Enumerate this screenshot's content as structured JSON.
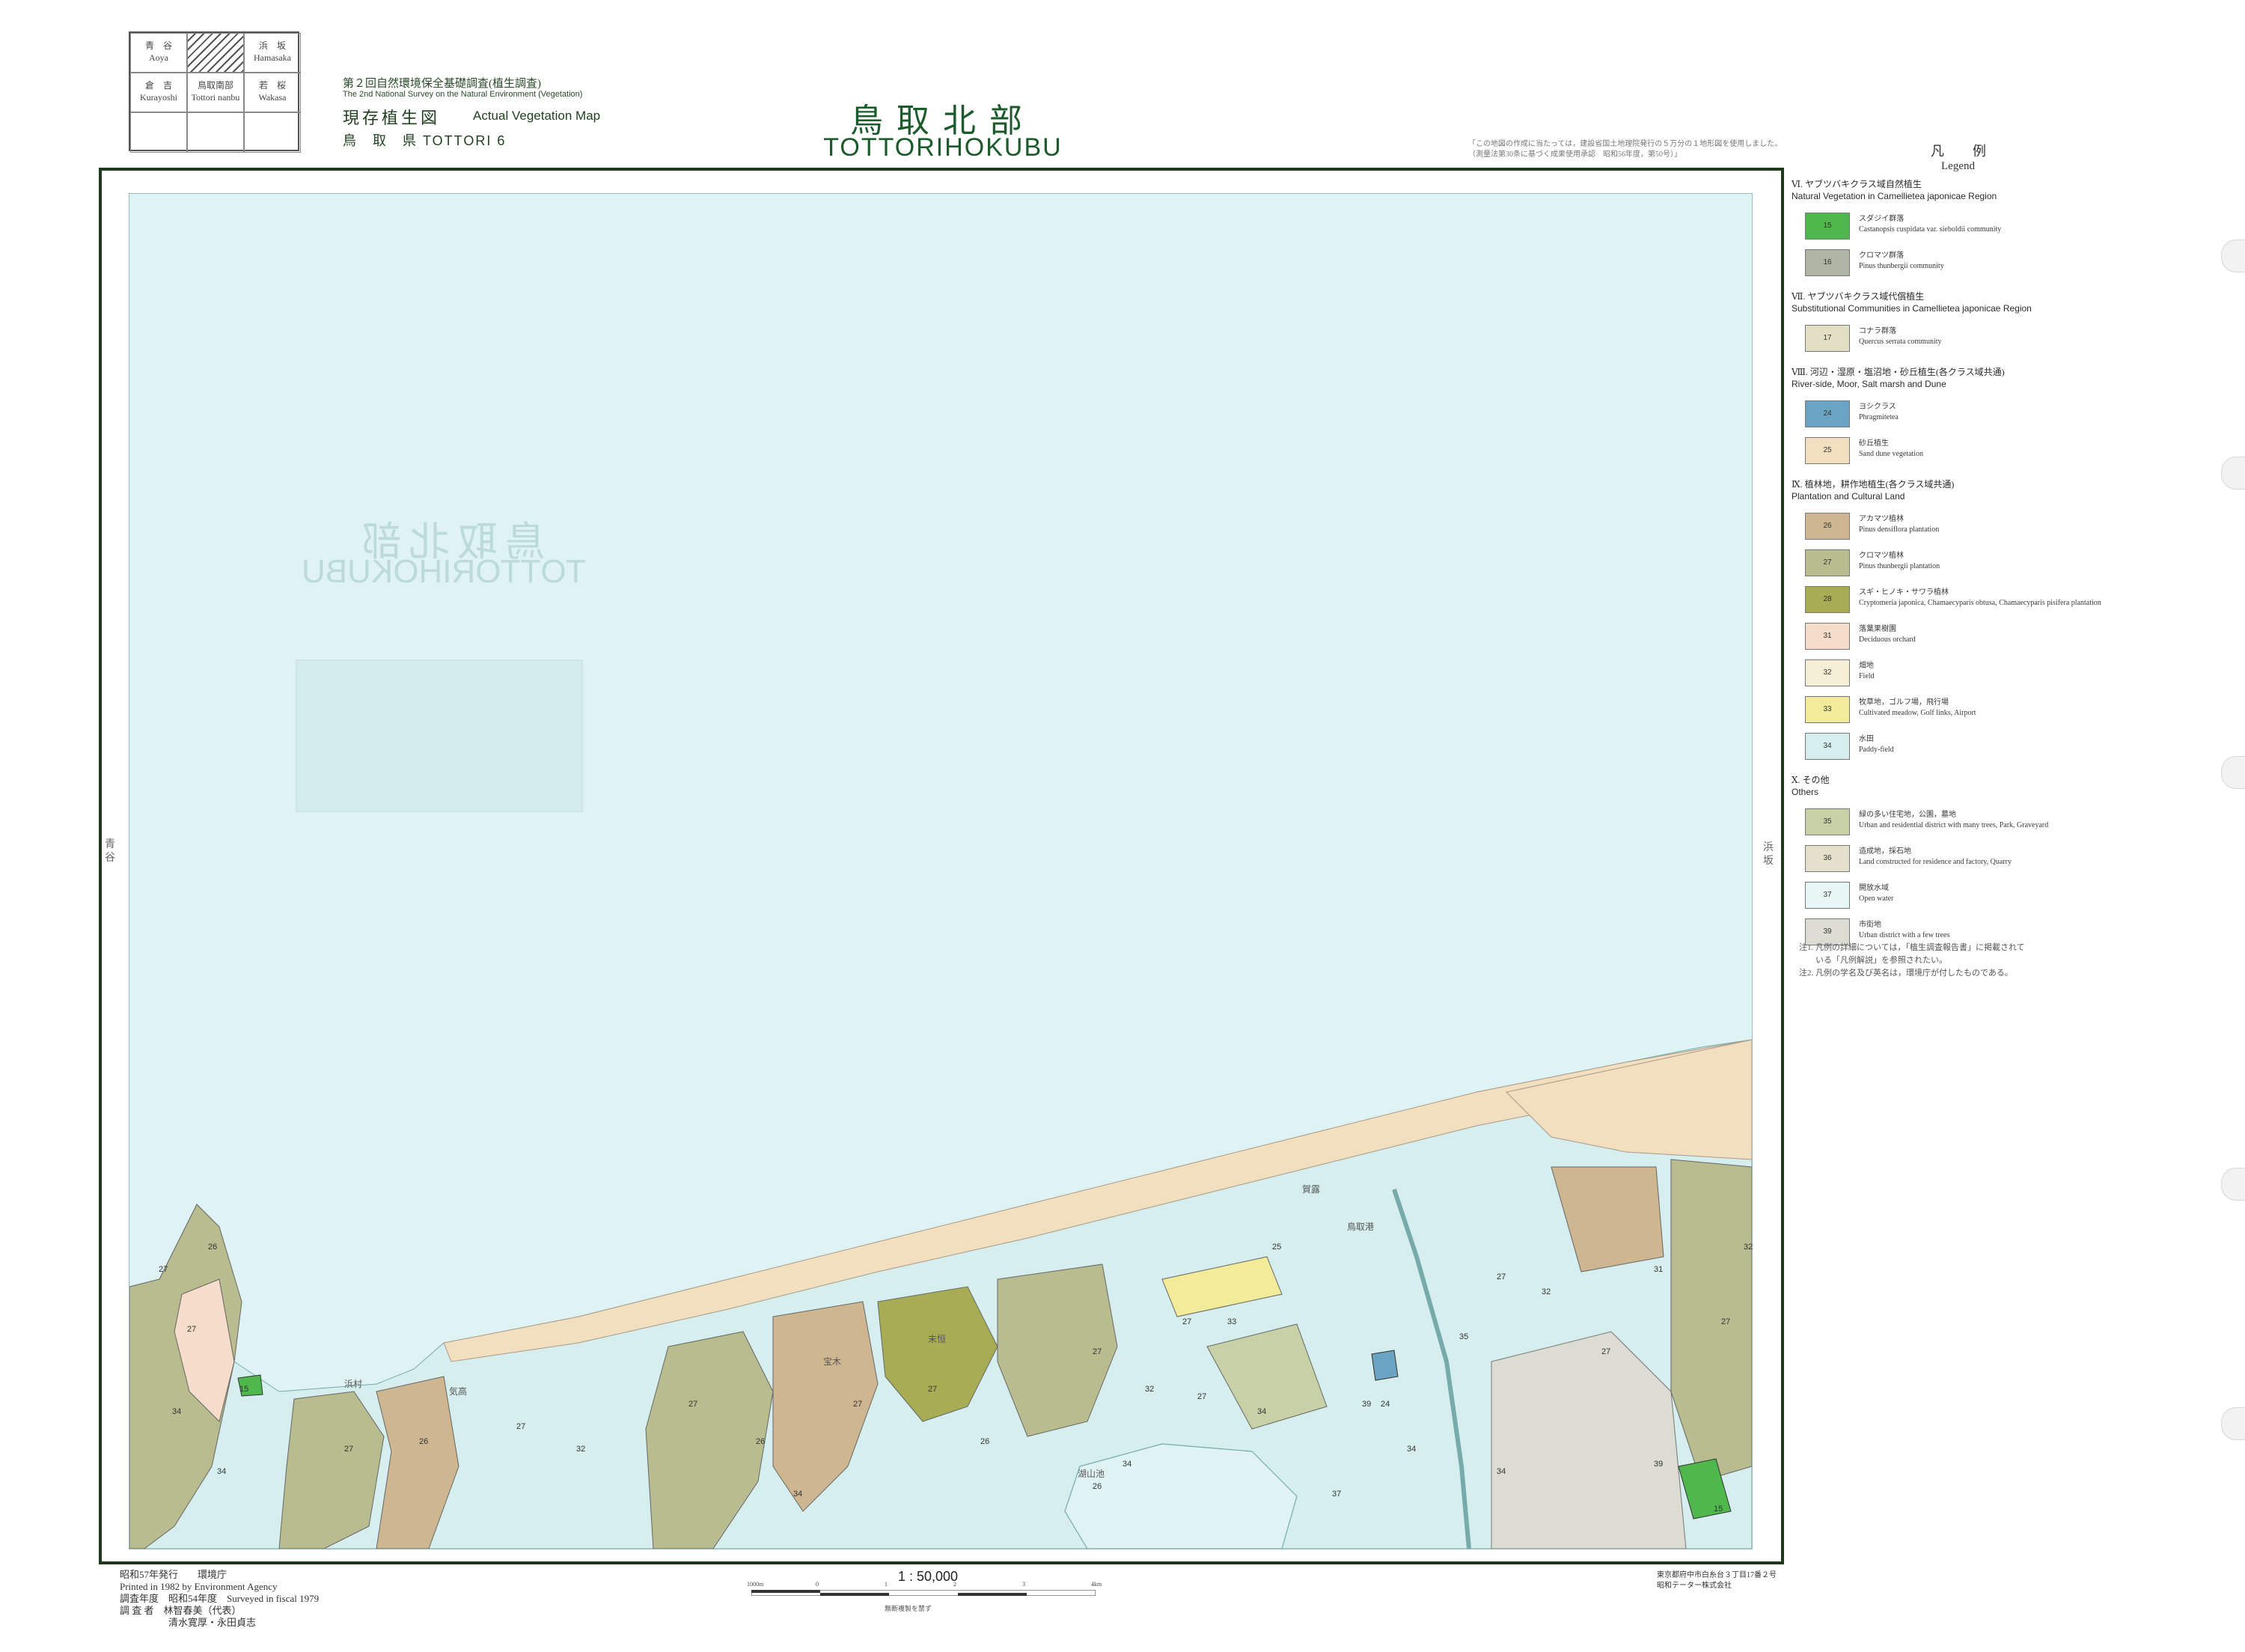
{
  "index_grid": [
    {
      "jp": "青　谷",
      "en": "Aoya"
    },
    {
      "jp": "",
      "en": ""
    },
    {
      "jp": "浜　坂",
      "en": "Hamasaka"
    },
    {
      "jp": "倉　吉",
      "en": "Kurayoshi"
    },
    {
      "jp": "鳥取南部",
      "en": "Tottori nanbu"
    },
    {
      "jp": "若　桜",
      "en": "Wakasa"
    }
  ],
  "header": {
    "survey_jp": "第２回自然環境保全基礎調査(植生調査)",
    "survey_en": "The 2nd National Survey on the Natural Environment (Vegetation)",
    "map_type_jp": "現存植生図",
    "map_type_en": "Actual Vegetation Map",
    "prefecture": "鳥　取　県  TOTTORI 6",
    "title_jp": "鳥取北部",
    "title_en": "TOTTORIHOKUBU",
    "top_note": "「この地図の作成に当たっては，建設省国土地理院発行の５万分の１地形図を使用しました。（測量法第30条に基づく成果使用承認　昭和56年度，第50号）」"
  },
  "map": {
    "ghost_title_jp": "鳥取北部",
    "ghost_title_en": "TOTTORIHOKUBU",
    "labels": [
      "27",
      "27",
      "26",
      "15",
      "34",
      "34",
      "27",
      "26",
      "27",
      "32",
      "27",
      "26",
      "34",
      "27",
      "27",
      "26",
      "27",
      "32",
      "27",
      "25",
      "33",
      "39",
      "34",
      "24",
      "27",
      "32",
      "31",
      "27",
      "35",
      "39",
      "34",
      "15",
      "37",
      "26",
      "34",
      "27",
      "34",
      "27",
      "32"
    ],
    "places": [
      "湖山池",
      "鳥取港",
      "賀露",
      "浜村",
      "気高",
      "宝木",
      "末恒"
    ],
    "colors": {
      "sea": "#dff3f4",
      "pine_plantation": "#b9bc8f",
      "shiia": "#4fb84c",
      "quercus": "#e3dfc4",
      "red_pine": "#cdb690",
      "dune": "#f1dfc0",
      "paddy": "#d6eeee",
      "field": "#f4efd5",
      "cedar": "#a8ad55",
      "meadow": "#f2ec9a",
      "urban": "#dcdcd2",
      "phragmites": "#6aa4c2",
      "orchard": "#f5dccb",
      "residential_green": "#c8d1a6"
    }
  },
  "legend": {
    "title_jp": "凡　例",
    "title_en": "Legend",
    "sections": [
      {
        "title_jp": "Ⅵ. ヤブツバキクラス域自然植生",
        "title_en": "Natural Vegetation in Camellietea japonicae Region",
        "items": [
          {
            "code": "15",
            "jp": "スダジイ群落",
            "en": "Castanopsis cuspidata var. sieboldii community",
            "color": "#4fb84c"
          },
          {
            "code": "16",
            "jp": "クロマツ群落",
            "en": "Pinus thunbergii community",
            "color": "#b0b4a4"
          }
        ]
      },
      {
        "title_jp": "Ⅶ. ヤブツバキクラス域代償植生",
        "title_en": "Substitutional Communities in Camellietea japonicae Region",
        "items": [
          {
            "code": "17",
            "jp": "コナラ群落",
            "en": "Quercus serrata community",
            "color": "#e3dfc4"
          }
        ]
      },
      {
        "title_jp": "Ⅷ. 河辺・湿原・塩沼地・砂丘植生(各クラス域共通)",
        "title_en": "River-side, Moor, Salt marsh and Dune",
        "items": [
          {
            "code": "24",
            "jp": "ヨシクラス",
            "en": "Phragmitetea",
            "color": "#6aa4c2"
          },
          {
            "code": "25",
            "jp": "砂丘植生",
            "en": "Sand dune vegetation",
            "color": "#f1dfc0"
          }
        ]
      },
      {
        "title_jp": "Ⅸ. 植林地，耕作地植生(各クラス域共通)",
        "title_en": "Plantation and Cultural Land",
        "items": [
          {
            "code": "26",
            "jp": "アカマツ植林",
            "en": "Pinus densiflora plantation",
            "color": "#cdb690"
          },
          {
            "code": "27",
            "jp": "クロマツ植林",
            "en": "Pinus thunbergii plantation",
            "color": "#b9bc8f"
          },
          {
            "code": "28",
            "jp": "スギ・ヒノキ・サワラ植林",
            "en": "Cryptomeria japonica, Chamaecyparis obtusa, Chamaecyparis pisifera plantation",
            "color": "#a8ad55"
          },
          {
            "code": "31",
            "jp": "落葉果樹園",
            "en": "Deciduous orchard",
            "color": "#f5dccb"
          },
          {
            "code": "32",
            "jp": "畑地",
            "en": "Field",
            "color": "#f4efd5"
          },
          {
            "code": "33",
            "jp": "牧草地，ゴルフ場，飛行場",
            "en": "Cultivated meadow, Golf links, Airport",
            "color": "#f2ec9a"
          },
          {
            "code": "34",
            "jp": "水田",
            "en": "Paddy-field",
            "color": "#d6eeee"
          }
        ]
      },
      {
        "title_jp": "Ⅹ. その他",
        "title_en": "Others",
        "items": [
          {
            "code": "35",
            "jp": "緑の多い住宅地，公園，墓地",
            "en": "Urban and residential district with many trees, Park, Graveyard",
            "color": "#c8d1a6"
          },
          {
            "code": "36",
            "jp": "造成地，採石地",
            "en": "Land constructed for residence and factory, Quarry",
            "color": "#e4e0cc"
          },
          {
            "code": "37",
            "jp": "開放水域",
            "en": "Open water",
            "color": "#e8f6f6"
          },
          {
            "code": "39",
            "jp": "市街地",
            "en": "Urban district with a few trees",
            "color": "#dcdcd2"
          }
        ]
      }
    ],
    "notes": [
      "注1. 凡例の詳細については，「植生調査報告書」に掲載されて",
      "　　いる「凡例解説」を参照されたい。",
      "注2. 凡例の学名及び英名は，環境庁が付したものである。"
    ]
  },
  "footer": {
    "published_jp": "昭和57年発行　　環境庁",
    "printed_en": "Printed in 1982 by Environment Agency",
    "surveyed": "調査年度　昭和54年度　Surveyed in fiscal 1979",
    "surveyors_1": "調 査 者　林智春美（代表）",
    "surveyors_2": "　　　　　清水寛厚・永田貞志",
    "scale": "1 : 50,000",
    "scale_ticks": [
      "1000m",
      "0",
      "1",
      "2",
      "3",
      "4km"
    ],
    "scale_note": "無断複製を禁ず",
    "printer_1": "東京都府中市白糸台３丁目17番２号",
    "printer_2": "昭和テーター株式会社",
    "side_left": "青谷",
    "side_right": "浜坂"
  }
}
